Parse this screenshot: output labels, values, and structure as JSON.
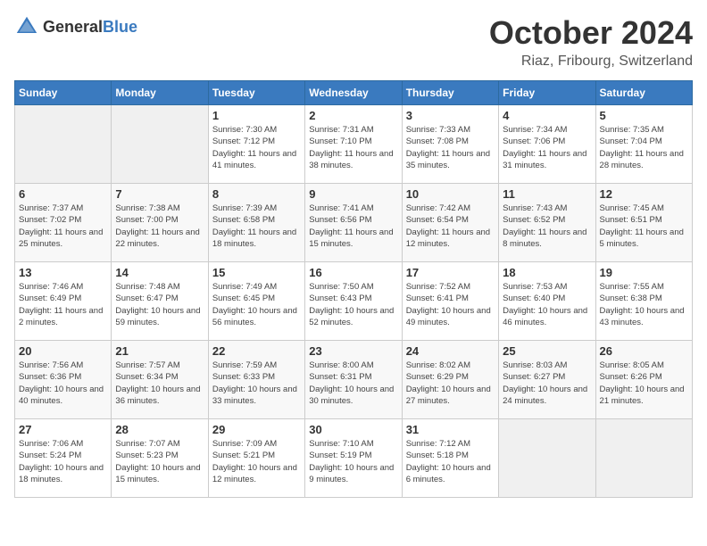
{
  "header": {
    "logo_general": "General",
    "logo_blue": "Blue",
    "month_title": "October 2024",
    "location": "Riaz, Fribourg, Switzerland"
  },
  "days_of_week": [
    "Sunday",
    "Monday",
    "Tuesday",
    "Wednesday",
    "Thursday",
    "Friday",
    "Saturday"
  ],
  "weeks": [
    [
      {
        "day": "",
        "info": ""
      },
      {
        "day": "",
        "info": ""
      },
      {
        "day": "1",
        "info": "Sunrise: 7:30 AM\nSunset: 7:12 PM\nDaylight: 11 hours and 41 minutes."
      },
      {
        "day": "2",
        "info": "Sunrise: 7:31 AM\nSunset: 7:10 PM\nDaylight: 11 hours and 38 minutes."
      },
      {
        "day": "3",
        "info": "Sunrise: 7:33 AM\nSunset: 7:08 PM\nDaylight: 11 hours and 35 minutes."
      },
      {
        "day": "4",
        "info": "Sunrise: 7:34 AM\nSunset: 7:06 PM\nDaylight: 11 hours and 31 minutes."
      },
      {
        "day": "5",
        "info": "Sunrise: 7:35 AM\nSunset: 7:04 PM\nDaylight: 11 hours and 28 minutes."
      }
    ],
    [
      {
        "day": "6",
        "info": "Sunrise: 7:37 AM\nSunset: 7:02 PM\nDaylight: 11 hours and 25 minutes."
      },
      {
        "day": "7",
        "info": "Sunrise: 7:38 AM\nSunset: 7:00 PM\nDaylight: 11 hours and 22 minutes."
      },
      {
        "day": "8",
        "info": "Sunrise: 7:39 AM\nSunset: 6:58 PM\nDaylight: 11 hours and 18 minutes."
      },
      {
        "day": "9",
        "info": "Sunrise: 7:41 AM\nSunset: 6:56 PM\nDaylight: 11 hours and 15 minutes."
      },
      {
        "day": "10",
        "info": "Sunrise: 7:42 AM\nSunset: 6:54 PM\nDaylight: 11 hours and 12 minutes."
      },
      {
        "day": "11",
        "info": "Sunrise: 7:43 AM\nSunset: 6:52 PM\nDaylight: 11 hours and 8 minutes."
      },
      {
        "day": "12",
        "info": "Sunrise: 7:45 AM\nSunset: 6:51 PM\nDaylight: 11 hours and 5 minutes."
      }
    ],
    [
      {
        "day": "13",
        "info": "Sunrise: 7:46 AM\nSunset: 6:49 PM\nDaylight: 11 hours and 2 minutes."
      },
      {
        "day": "14",
        "info": "Sunrise: 7:48 AM\nSunset: 6:47 PM\nDaylight: 10 hours and 59 minutes."
      },
      {
        "day": "15",
        "info": "Sunrise: 7:49 AM\nSunset: 6:45 PM\nDaylight: 10 hours and 56 minutes."
      },
      {
        "day": "16",
        "info": "Sunrise: 7:50 AM\nSunset: 6:43 PM\nDaylight: 10 hours and 52 minutes."
      },
      {
        "day": "17",
        "info": "Sunrise: 7:52 AM\nSunset: 6:41 PM\nDaylight: 10 hours and 49 minutes."
      },
      {
        "day": "18",
        "info": "Sunrise: 7:53 AM\nSunset: 6:40 PM\nDaylight: 10 hours and 46 minutes."
      },
      {
        "day": "19",
        "info": "Sunrise: 7:55 AM\nSunset: 6:38 PM\nDaylight: 10 hours and 43 minutes."
      }
    ],
    [
      {
        "day": "20",
        "info": "Sunrise: 7:56 AM\nSunset: 6:36 PM\nDaylight: 10 hours and 40 minutes."
      },
      {
        "day": "21",
        "info": "Sunrise: 7:57 AM\nSunset: 6:34 PM\nDaylight: 10 hours and 36 minutes."
      },
      {
        "day": "22",
        "info": "Sunrise: 7:59 AM\nSunset: 6:33 PM\nDaylight: 10 hours and 33 minutes."
      },
      {
        "day": "23",
        "info": "Sunrise: 8:00 AM\nSunset: 6:31 PM\nDaylight: 10 hours and 30 minutes."
      },
      {
        "day": "24",
        "info": "Sunrise: 8:02 AM\nSunset: 6:29 PM\nDaylight: 10 hours and 27 minutes."
      },
      {
        "day": "25",
        "info": "Sunrise: 8:03 AM\nSunset: 6:27 PM\nDaylight: 10 hours and 24 minutes."
      },
      {
        "day": "26",
        "info": "Sunrise: 8:05 AM\nSunset: 6:26 PM\nDaylight: 10 hours and 21 minutes."
      }
    ],
    [
      {
        "day": "27",
        "info": "Sunrise: 7:06 AM\nSunset: 5:24 PM\nDaylight: 10 hours and 18 minutes."
      },
      {
        "day": "28",
        "info": "Sunrise: 7:07 AM\nSunset: 5:23 PM\nDaylight: 10 hours and 15 minutes."
      },
      {
        "day": "29",
        "info": "Sunrise: 7:09 AM\nSunset: 5:21 PM\nDaylight: 10 hours and 12 minutes."
      },
      {
        "day": "30",
        "info": "Sunrise: 7:10 AM\nSunset: 5:19 PM\nDaylight: 10 hours and 9 minutes."
      },
      {
        "day": "31",
        "info": "Sunrise: 7:12 AM\nSunset: 5:18 PM\nDaylight: 10 hours and 6 minutes."
      },
      {
        "day": "",
        "info": ""
      },
      {
        "day": "",
        "info": ""
      }
    ]
  ]
}
